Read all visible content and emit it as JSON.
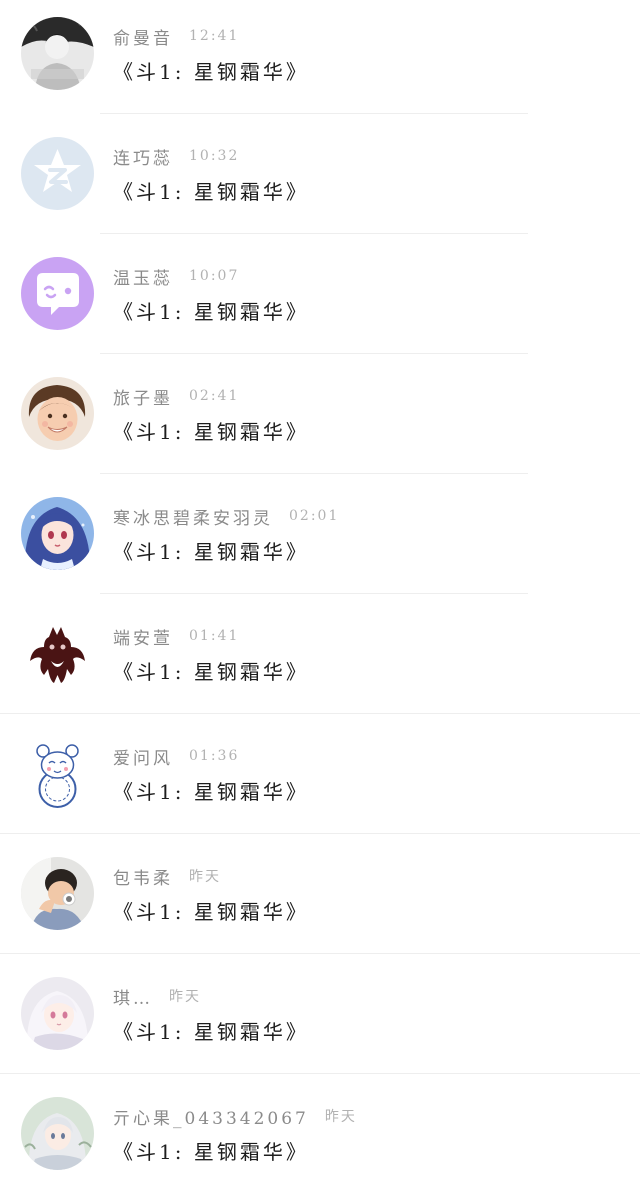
{
  "chat_list": {
    "items": [
      {
        "name": "俞曼音",
        "time": "12:41",
        "message": "《斗1: 星钢霜华》",
        "avatar_icon": "avatar-photo-icon"
      },
      {
        "name": "连巧蕊",
        "time": "10:32",
        "message": "《斗1: 星钢霜华》",
        "avatar_icon": "qzone-default-avatar-icon"
      },
      {
        "name": "温玉蕊",
        "time": "10:07",
        "message": "《斗1: 星钢霜华》",
        "avatar_icon": "chat-bubble-avatar-icon"
      },
      {
        "name": "旅子墨",
        "time": "02:41",
        "message": "《斗1: 星钢霜华》",
        "avatar_icon": "child-photo-avatar-icon"
      },
      {
        "name": "寒冰思碧柔安羽灵",
        "time": "02:01",
        "message": "《斗1: 星钢霜华》",
        "avatar_icon": "anime-girl-avatar-icon"
      },
      {
        "name": "端安萱",
        "time": "01:41",
        "message": "《斗1: 星钢霜华》",
        "avatar_icon": "dark-creature-avatar-icon"
      },
      {
        "name": "爱问风",
        "time": "01:36",
        "message": "《斗1: 星钢霜华》",
        "avatar_icon": "porcelain-bear-avatar-icon"
      },
      {
        "name": "包韦柔",
        "time": "昨天",
        "message": "《斗1: 星钢霜华》",
        "avatar_icon": "boy-photo-avatar-icon"
      },
      {
        "name": "琪…",
        "time": "昨天",
        "message": "《斗1: 星钢霜华》",
        "avatar_icon": "white-hair-girl-avatar-icon"
      },
      {
        "name": "亓心果_043342067",
        "time": "昨天",
        "message": "《斗1: 星钢霜华》",
        "avatar_icon": "silver-hair-girl-avatar-icon"
      }
    ]
  }
}
